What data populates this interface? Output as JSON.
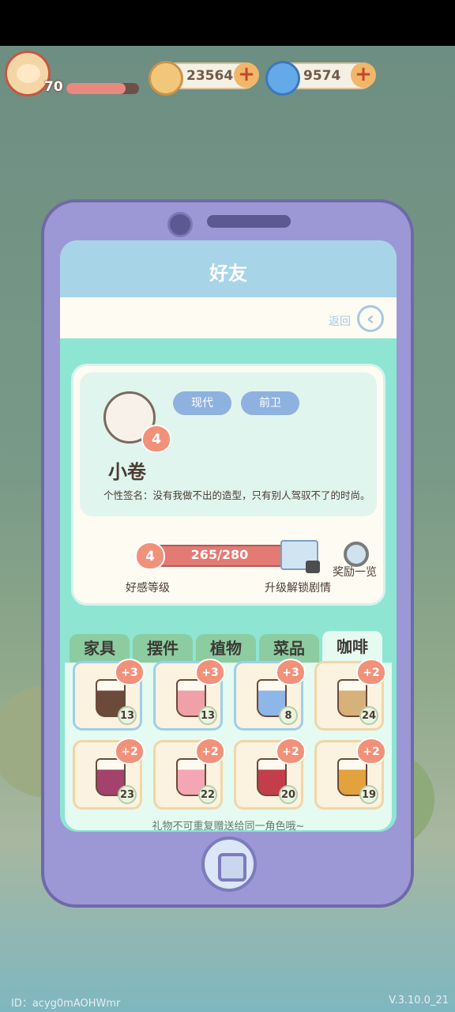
{
  "hud": {
    "level": "70",
    "level_progress": 0.82,
    "coins": "23564",
    "gems": "9574",
    "plus": "+"
  },
  "screen": {
    "title": "好友",
    "back_label": "返回",
    "back_icon": "chevron-left"
  },
  "profile": {
    "favor_level": "4",
    "tags": [
      "现代",
      "前卫"
    ],
    "name": "小卷",
    "signature": "个性签名：没有我做不出的造型，只有别人驾驭不了的时尚。",
    "favor_progress": "265/280",
    "favor_label": "好感等级",
    "unlock_label": "升级解锁剧情",
    "rewards_label": "奖励一览"
  },
  "tabs": [
    "家具",
    "摆件",
    "植物",
    "菜品",
    "咖啡"
  ],
  "active_tab": "咖啡",
  "gifts": [
    {
      "bonus": "+3",
      "count": "13",
      "color": "#6b4a3a"
    },
    {
      "bonus": "+3",
      "count": "13",
      "color": "#f0a0a8"
    },
    {
      "bonus": "+3",
      "count": "8",
      "color": "#8fb6e8"
    },
    {
      "bonus": "+2",
      "count": "24",
      "color": "#d7b07a"
    },
    {
      "bonus": "+2",
      "count": "23",
      "color": "#a3426b"
    },
    {
      "bonus": "+2",
      "count": "22",
      "color": "#f5a6b4"
    },
    {
      "bonus": "+2",
      "count": "20",
      "color": "#c43d4b"
    },
    {
      "bonus": "+2",
      "count": "19",
      "color": "#e2a23d"
    }
  ],
  "note": "礼物不可重复赠送给同一角色哦~",
  "footer": {
    "id": "ID：acyg0mAOHWmr",
    "version": "V.3.10.0_21"
  }
}
